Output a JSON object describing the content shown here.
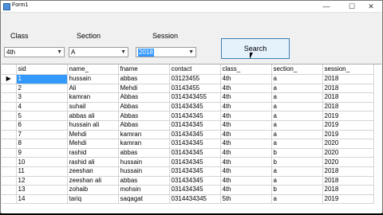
{
  "window": {
    "title": "Form1"
  },
  "filters": {
    "class": {
      "label": "Class",
      "value": "4th"
    },
    "section": {
      "label": "Section",
      "value": "A"
    },
    "session": {
      "label": "Session",
      "value": "2018"
    }
  },
  "search_label": "Search",
  "grid": {
    "columns": [
      "sid",
      "name_",
      "fname",
      "contact",
      "class_",
      "section_",
      "session_"
    ],
    "current_row_marker": "▶",
    "rows": [
      [
        "1",
        "hussain",
        "abbas",
        "03123455",
        "4th",
        "a",
        "2018"
      ],
      [
        "2",
        "Ali",
        "Mehdi",
        "03143455",
        "4th",
        "a",
        "2018"
      ],
      [
        "3",
        "kamran",
        "Abbas",
        "0314343455",
        "4th",
        "a",
        "2018"
      ],
      [
        "4",
        "suhail",
        "Abbas",
        "031434345",
        "4th",
        "a",
        "2018"
      ],
      [
        "5",
        "abbas ali",
        "Abbas",
        "031434345",
        "4th",
        "a",
        "2019"
      ],
      [
        "6",
        "hussain ali",
        "Abbas",
        "031434345",
        "4th",
        "a",
        "2019"
      ],
      [
        "7",
        "Mehdi",
        "kamran",
        "031434345",
        "4th",
        "a",
        "2019"
      ],
      [
        "8",
        "Mehdi",
        "kamran",
        "031434345",
        "4th",
        "a",
        "2020"
      ],
      [
        "9",
        "rashid",
        "abbas",
        "031434345",
        "4th",
        "b",
        "2020"
      ],
      [
        "10",
        "rashid ali",
        "hussain",
        "031434345",
        "4th",
        "b",
        "2020"
      ],
      [
        "11",
        "zeeshan",
        "hussain",
        "031434345",
        "4th",
        "a",
        "2018"
      ],
      [
        "12",
        "zeeshan ali",
        "abbas",
        "031434345",
        "4th",
        "a",
        "2018"
      ],
      [
        "13",
        "zohaib",
        "mohsin",
        "031434345",
        "4th",
        "b",
        "2018"
      ],
      [
        "14",
        "tariq",
        "saqagat",
        "0314434345",
        "5th",
        "a",
        "2019"
      ]
    ]
  }
}
